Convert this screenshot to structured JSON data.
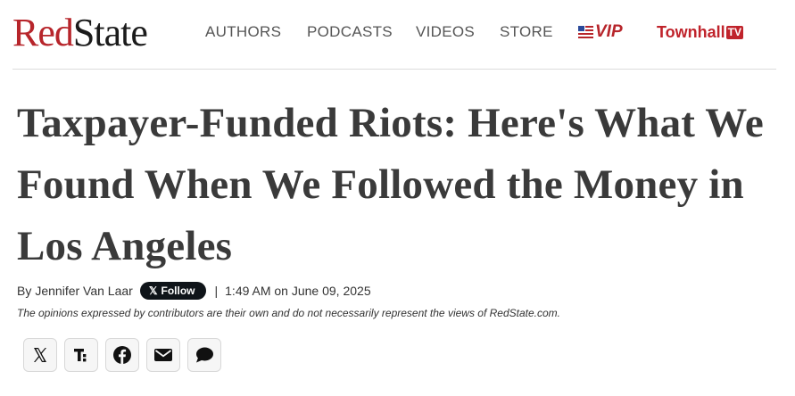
{
  "header": {
    "logo": {
      "part1": "Red",
      "part2": "State"
    },
    "nav": [
      {
        "label": "AUTHORS"
      },
      {
        "label": "PODCASTS"
      },
      {
        "label": "VIDEOS"
      },
      {
        "label": "STORE"
      }
    ],
    "vip_label": "VIP",
    "townhall_label": "Townhall",
    "townhall_tv": "TV"
  },
  "article": {
    "title": "Taxpayer-Funded Riots: Here's What We Found When We Followed the Money in Los Angeles",
    "by_prefix": "By",
    "author": "Jennifer Van Laar",
    "follow_label": "Follow",
    "separator": "|",
    "timestamp": "1:49 AM on June 09, 2025",
    "disclaimer": "The opinions expressed by contributors are their own and do not necessarily represent the views of RedState.com."
  },
  "share": [
    {
      "icon": "x-icon"
    },
    {
      "icon": "truth-social-icon"
    },
    {
      "icon": "facebook-icon"
    },
    {
      "icon": "email-icon"
    },
    {
      "icon": "comment-icon"
    }
  ],
  "colors": {
    "brand_red": "#b7252b",
    "title_text": "#3a3a3a",
    "follow_button": "#0f1419"
  }
}
